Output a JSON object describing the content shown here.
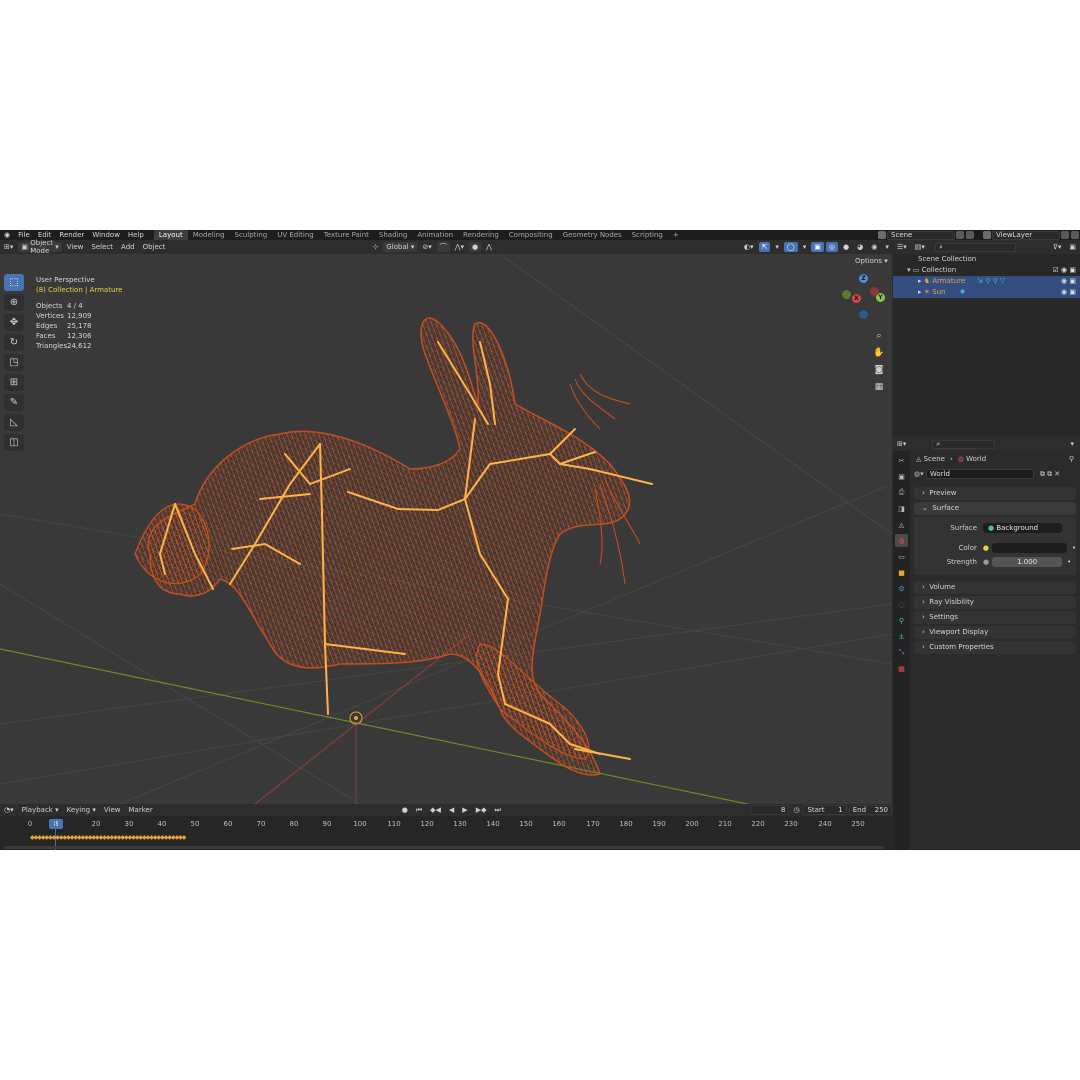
{
  "app": {
    "menus": [
      "File",
      "Edit",
      "Render",
      "Window",
      "Help"
    ],
    "workspaces": [
      "Layout",
      "Modeling",
      "Sculpting",
      "UV Editing",
      "Texture Paint",
      "Shading",
      "Animation",
      "Rendering",
      "Compositing",
      "Geometry Nodes",
      "Scripting"
    ],
    "active_workspace": "Layout",
    "add_tab": "+",
    "scene_name": "Scene",
    "view_layer": "ViewLayer"
  },
  "viewport_header": {
    "mode": "Object Mode",
    "menus": [
      "View",
      "Select",
      "Add",
      "Object"
    ],
    "transform_orientation": "Global",
    "options_label": "Options"
  },
  "viewport": {
    "perspective": "User Perspective",
    "collection": "(8) Collection | Armature",
    "stats": [
      {
        "label": "Objects",
        "value": "4 / 4"
      },
      {
        "label": "Vertices",
        "value": "12,909"
      },
      {
        "label": "Edges",
        "value": "25,178"
      },
      {
        "label": "Faces",
        "value": "12,306"
      },
      {
        "label": "Triangles",
        "value": "24,612"
      }
    ],
    "gizmo": {
      "z": "Z",
      "y": "Y",
      "x": "X"
    },
    "colors": {
      "mesh_wire": "#c9501f",
      "bones": "#ffb347",
      "floor_x": "#8a3b3b",
      "floor_y": "#6b8a2a",
      "grid": "#464646"
    }
  },
  "timeline": {
    "menus": [
      "Playback",
      "Keying",
      "View",
      "Marker"
    ],
    "current_frame": "8",
    "start_label": "Start",
    "start": "1",
    "end_label": "End",
    "end": "250",
    "ticks": [
      "0",
      "8",
      "20",
      "30",
      "40",
      "50",
      "60",
      "70",
      "80",
      "90",
      "100",
      "110",
      "120",
      "130",
      "140",
      "150",
      "160",
      "170",
      "180",
      "190",
      "200",
      "210",
      "220",
      "230",
      "240",
      "250"
    ]
  },
  "outliner": {
    "root": "Scene Collection",
    "collection": "Collection",
    "items": [
      {
        "name": "Armature",
        "selected": true
      },
      {
        "name": "Sun",
        "selected": true
      }
    ]
  },
  "properties": {
    "breadcrumb_scene": "Scene",
    "breadcrumb_world": "World",
    "world_name": "World",
    "panels_top": [
      "Preview",
      "Surface"
    ],
    "surface": {
      "surface_label": "Surface",
      "surface_value": "Background",
      "color_label": "Color",
      "strength_label": "Strength",
      "strength_value": "1.000"
    },
    "panels_bottom": [
      "Volume",
      "Ray Visibility",
      "Settings",
      "Viewport Display",
      "Custom Properties"
    ]
  }
}
